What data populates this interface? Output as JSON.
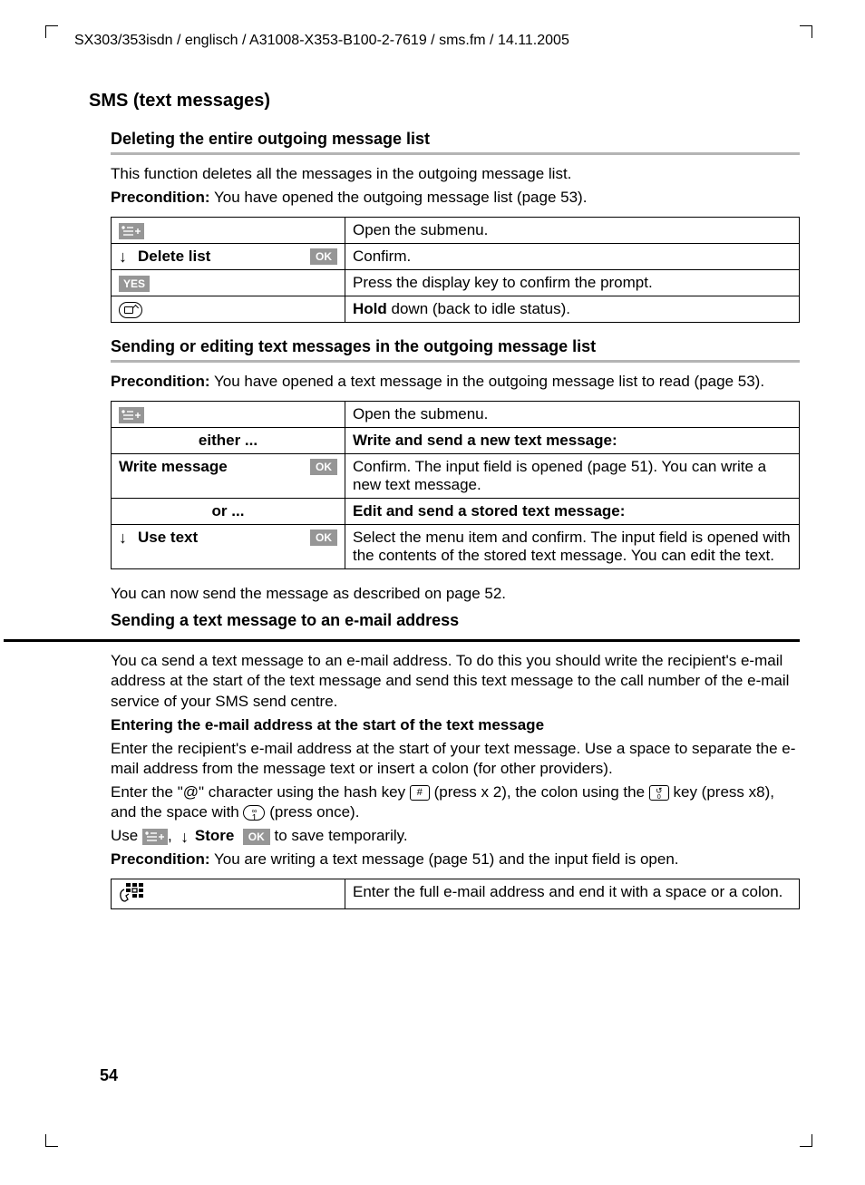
{
  "header": "SX303/353isdn / englisch / A31008-X353-B100-2-7619 / sms.fm / 14.11.2005",
  "h1": "SMS (text messages)",
  "sec1": {
    "title": "Deleting the entire outgoing message list",
    "p1": "This function deletes all the messages in the outgoing message list.",
    "pre_label": "Precondition:",
    "pre_text": " You have opened the outgoing message list (page 53).",
    "rows": [
      {
        "right": "Open the submenu."
      },
      {
        "label": "Delete list",
        "right": "Confirm."
      },
      {
        "yes": "YES",
        "right": "Press the display key to confirm the prompt."
      },
      {
        "hold_b": "Hold",
        "hold_rest": " down (back to idle status)."
      }
    ]
  },
  "sec2": {
    "title": "Sending or editing text messages in the outgoing message list",
    "pre_label": "Precondition:",
    "pre_text": " You have opened a text message in the outgoing message list to read (page 53).",
    "rows": [
      {
        "right": "Open the submenu."
      },
      {
        "left_b": "either ...",
        "right_b": "Write and send a new text message:"
      },
      {
        "label": "Write message",
        "right": "Confirm. The input field is opened (page 51). You can write a new text message."
      },
      {
        "left_b": "or ...",
        "right_b": "Edit and send a stored text message:"
      },
      {
        "label": "Use text",
        "right": "Select the menu item and confirm. The input field is opened with the contents of the stored text message. You can edit the text."
      }
    ],
    "after": "You can now send the message as described on page 52."
  },
  "sec3": {
    "title": "Sending a text message to an e-mail address",
    "p1": "You ca send a text message to an e-mail address. To do this you should write the recipient's e-mail address at the start of the text message and send this text message to the call number of the e-mail service of your SMS send centre.",
    "h_bold": "Entering the e-mail address at the start of the text message",
    "p2": "Enter the recipient's e-mail address at the start of your text message. Use a space to separate the e-mail address from the message text or insert a colon (for other providers).",
    "p3a": "Enter the \"@\" character using the hash key ",
    "p3b": " (press x 2), the colon using the ",
    "p3c": " key (press x8), and the space with ",
    "p3d": " (press once).",
    "p4a": "Use ",
    "p4_store": "Store",
    "p4b": " to save temporarily.",
    "pre_label": "Precondition:",
    "pre_text": " You are writing a text message (page 51) and the input field is open.",
    "rows": [
      {
        "right": "Enter the full e-mail address and end it with a space or a colon."
      }
    ]
  },
  "ok_label": "OK",
  "page_number": "54"
}
